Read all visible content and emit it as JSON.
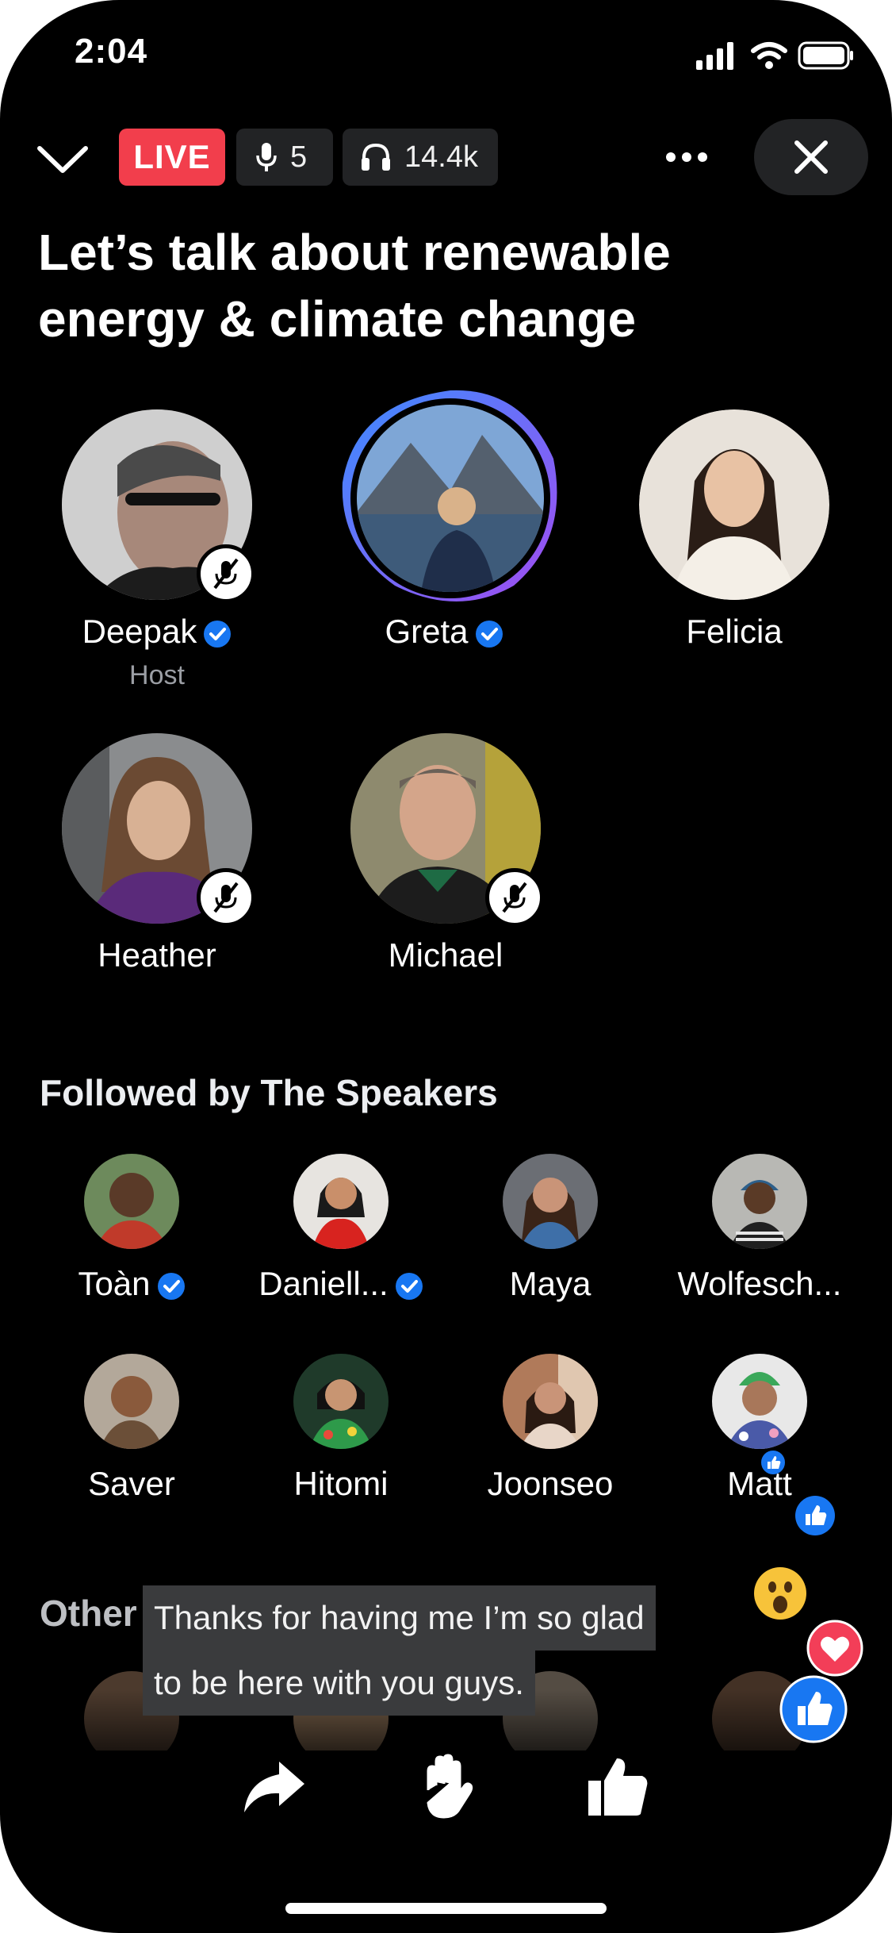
{
  "status_bar": {
    "time": "2:04"
  },
  "header": {
    "live_label": "LIVE",
    "speaker_count": "5",
    "listener_count": "14.4k",
    "title": "Let’s talk about renewable energy & climate change"
  },
  "speakers": [
    {
      "name": "Deepak",
      "subtitle": "Host",
      "verified": true,
      "muted": true
    },
    {
      "name": "Greta",
      "verified": true,
      "speaking": true
    },
    {
      "name": "Felicia"
    },
    {
      "name": "Heather",
      "muted": true
    },
    {
      "name": "Michael",
      "muted": true
    }
  ],
  "followed": {
    "heading": "Followed by The Speakers",
    "people": [
      {
        "name": "Toàn",
        "verified": true
      },
      {
        "name": "Daniell...",
        "verified": true
      },
      {
        "name": "Maya"
      },
      {
        "name": "Wolfesch..."
      },
      {
        "name": "Saver"
      },
      {
        "name": "Hitomi"
      },
      {
        "name": "Joonseo"
      },
      {
        "name": "Matt"
      }
    ]
  },
  "others": {
    "heading": "Other"
  },
  "caption": {
    "line1": "Thanks for having me I’m so glad",
    "line2": "to be here with you guys."
  },
  "colors": {
    "live": "#f23e4c",
    "verified": "#1877f2",
    "heart": "#f33e58",
    "background": "#000000"
  },
  "icons": [
    "chevron-down-icon",
    "microphone-icon",
    "headphones-icon",
    "more-icon",
    "close-icon",
    "share-icon",
    "raise-hand-icon",
    "like-icon"
  ]
}
